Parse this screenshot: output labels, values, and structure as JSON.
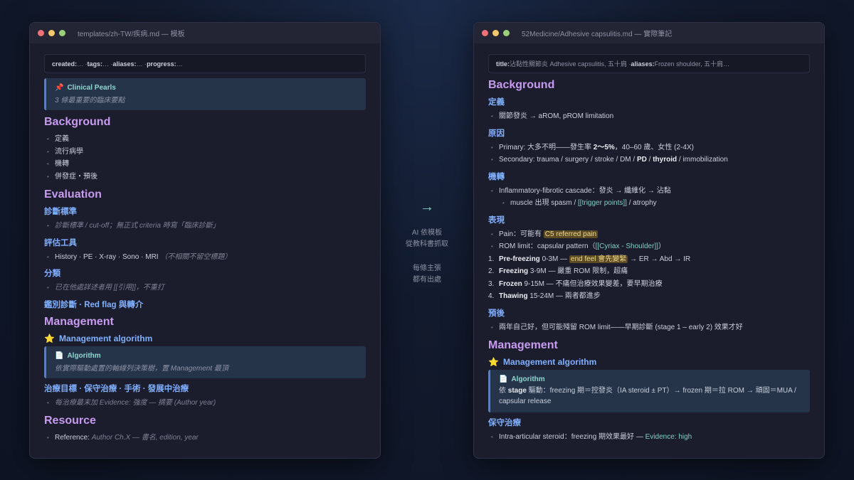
{
  "left": {
    "title": "templates/zh-TW/疾病.md — 模板",
    "frontmatter": {
      "created_key": "created:",
      "created_val": " … · ",
      "tags_key": "tags:",
      "tags_val": " … · ",
      "aliases_key": "aliases:",
      "aliases_val": " … · ",
      "progress_key": "progress:",
      "progress_val": " …"
    },
    "pearls": {
      "icon": "pin-icon",
      "title": "Clinical Pearls",
      "body": "3 條最重要的臨床要點"
    },
    "background": {
      "heading": "Background",
      "items": [
        "定義",
        "流行病學",
        "機轉",
        "併發症・預後"
      ]
    },
    "evaluation": {
      "heading": "Evaluation",
      "dx_heading": "診斷標準",
      "dx_item": "診斷標準 / cut-off；無正式 criteria 時寫「臨床診斷」",
      "tools_heading": "評估工具",
      "tools_item": "History · PE · X-ray · Sono · MRI",
      "tools_note": "（不相關不留空標題）",
      "class_heading": "分類",
      "class_item": "已在他處詳述者用 [[引用]]，不重打",
      "ddx_heading": "鑑別診斷 · Red flag 與轉介"
    },
    "management": {
      "heading": "Management",
      "algo_heading": "Management algorithm",
      "algo_callout_title": "Algorithm",
      "algo_callout_body": "依實際驅動處置的軸線列決策樹，置 Management 最頂",
      "tx_heading": "治療目標 · 保守治療 · 手術 · 發展中治療",
      "tx_item": "每治療最末加 Evidence: 強度 — 摘要 (Author year)"
    },
    "resource": {
      "heading": "Resource",
      "ref_label": "Reference: ",
      "ref_val": "Author Ch.X — 書名, edition, year"
    }
  },
  "center": {
    "arrow": "→",
    "line1": "AI 依模板",
    "line2": "從教科書抓取",
    "line3": "每條主張",
    "line4": "都有出處"
  },
  "right": {
    "title": "52Medicine/Adhesive capsulitis.md — 實際筆記",
    "frontmatter": {
      "title_key": "title:",
      "title_val": " 沾黏性關節炎 Adhesive capsulitis, 五十肩 · ",
      "aliases_key": "aliases:",
      "aliases_val": " Frozen shoulder, 五十肩…"
    },
    "background": {
      "heading": "Background",
      "def_heading": "定義",
      "def_item": "關節發炎 → aROM, pROM limitation",
      "cause_heading": "原因",
      "cause1_a": "Primary: 大多不明——發生率 ",
      "cause1_b": "2〜5%",
      "cause1_c": "，40–60 歲、女性 (2-4X)",
      "cause2_a": "Secondary: trauma / surgery / stroke / DM / ",
      "cause2_b": "PD",
      "cause2_c": " / ",
      "cause2_d": "thyroid",
      "cause2_e": " / immobilization",
      "mech_heading": "機轉",
      "mech1": "Inflammatory-fibrotic cascade：發炎 → 纖維化 → 沾黏",
      "mech2_a": "muscle 出現 spasm / ",
      "mech2_b": "[[trigger points]]",
      "mech2_c": " / atrophy",
      "pres_heading": "表現",
      "pain_a": "Pain：可能有 ",
      "pain_b": "C5 referred pain",
      "rom_a": "ROM limit：capsular pattern（",
      "rom_b": "[[Cyriax - Shoulder]]",
      "rom_c": "）",
      "stages": [
        {
          "n": "1.",
          "name": "Pre-freezing",
          "pre": " 0-3M — ",
          "hl": "end feel 會先變緊",
          "post": " → ER → Abd → IR"
        },
        {
          "n": "2.",
          "name": "Freezing",
          "pre": " 3-9M — 嚴重 ROM 限制，超痛",
          "hl": "",
          "post": ""
        },
        {
          "n": "3.",
          "name": "Frozen",
          "pre": " 9-15M — 不痛但治療效果變差，要早期治療",
          "hl": "",
          "post": ""
        },
        {
          "n": "4.",
          "name": "Thawing",
          "pre": " 15-24M — 兩者都進步",
          "hl": "",
          "post": ""
        }
      ],
      "prog_heading": "預後",
      "prog_item": "兩年自己好，但可能殘留 ROM limit——早期診斷 (stage 1 – early 2) 效果才好"
    },
    "management": {
      "heading": "Management",
      "algo_heading": "Management algorithm",
      "algo_callout_title": "Algorithm",
      "algo_body_a": "依 ",
      "algo_body_b": "stage",
      "algo_body_c": " 驅動：freezing 期＝控發炎（IA steroid ± PT）→ frozen 期＝拉 ROM → 頑固＝MUA / capsular release",
      "cons_heading": "保守治療",
      "cons_item_a": "Intra-articular steroid：freezing 期效果最好 — ",
      "cons_item_b": "Evidence: high"
    }
  }
}
